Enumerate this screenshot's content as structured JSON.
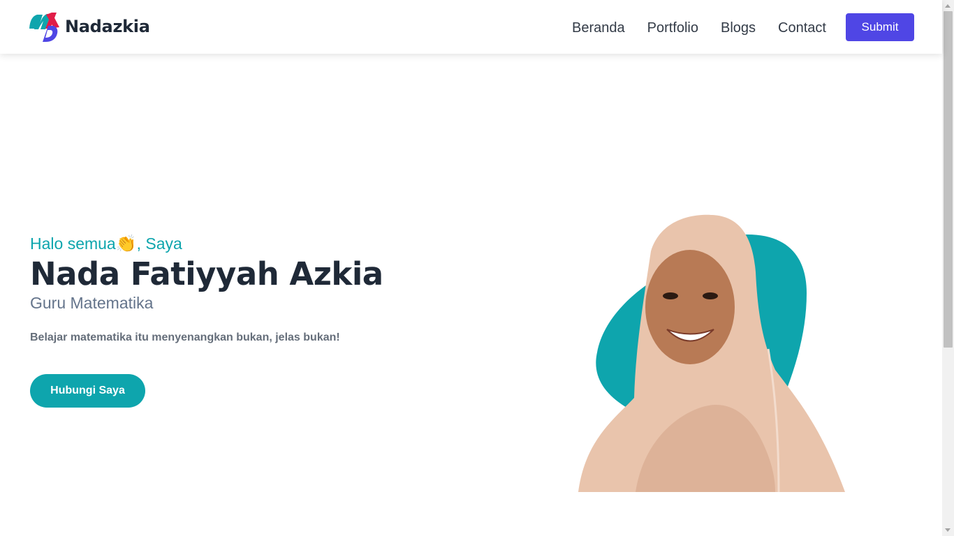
{
  "brand": {
    "name": "Nadazkia",
    "logo_icon": "nad-logo-icon"
  },
  "nav": {
    "links": [
      "Beranda",
      "Portfolio",
      "Blogs",
      "Contact"
    ],
    "submit_label": "Submit",
    "submit_color": "#4f46e5"
  },
  "hero": {
    "greeting": "Halo semua",
    "wave_emoji": "👏",
    "greeting_suffix": ", Saya",
    "name": "Nada Fatiyyah Azkia",
    "role": "Guru Matematika",
    "description": "Belajar matematika itu menyenangkan bukan, jelas bukan!",
    "cta_label": "Hubungi Saya",
    "accent_color": "#0ea5ad"
  },
  "portrait": {
    "icon": "profile-photo"
  }
}
